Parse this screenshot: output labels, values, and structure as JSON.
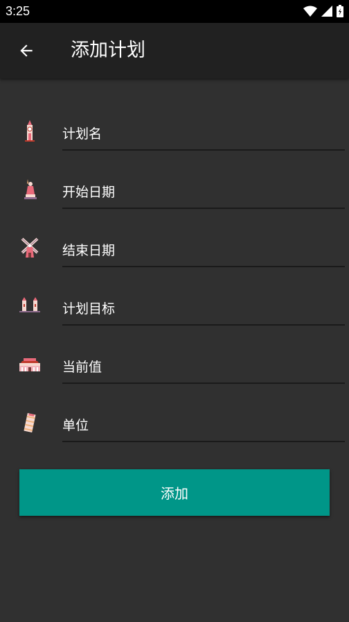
{
  "status_bar": {
    "time": "3:25"
  },
  "app_bar": {
    "title": "添加计划"
  },
  "form": {
    "fields": [
      {
        "label": "计划名",
        "icon": "clock-tower-icon"
      },
      {
        "label": "开始日期",
        "icon": "statue-icon"
      },
      {
        "label": "结束日期",
        "icon": "windmill-icon"
      },
      {
        "label": "计划目标",
        "icon": "bridge-towers-icon"
      },
      {
        "label": "当前值",
        "icon": "gate-building-icon"
      },
      {
        "label": "单位",
        "icon": "leaning-tower-icon"
      }
    ]
  },
  "add_button": {
    "label": "添加"
  },
  "colors": {
    "accent": "#009688",
    "background": "#303030",
    "app_bar": "#212121"
  }
}
